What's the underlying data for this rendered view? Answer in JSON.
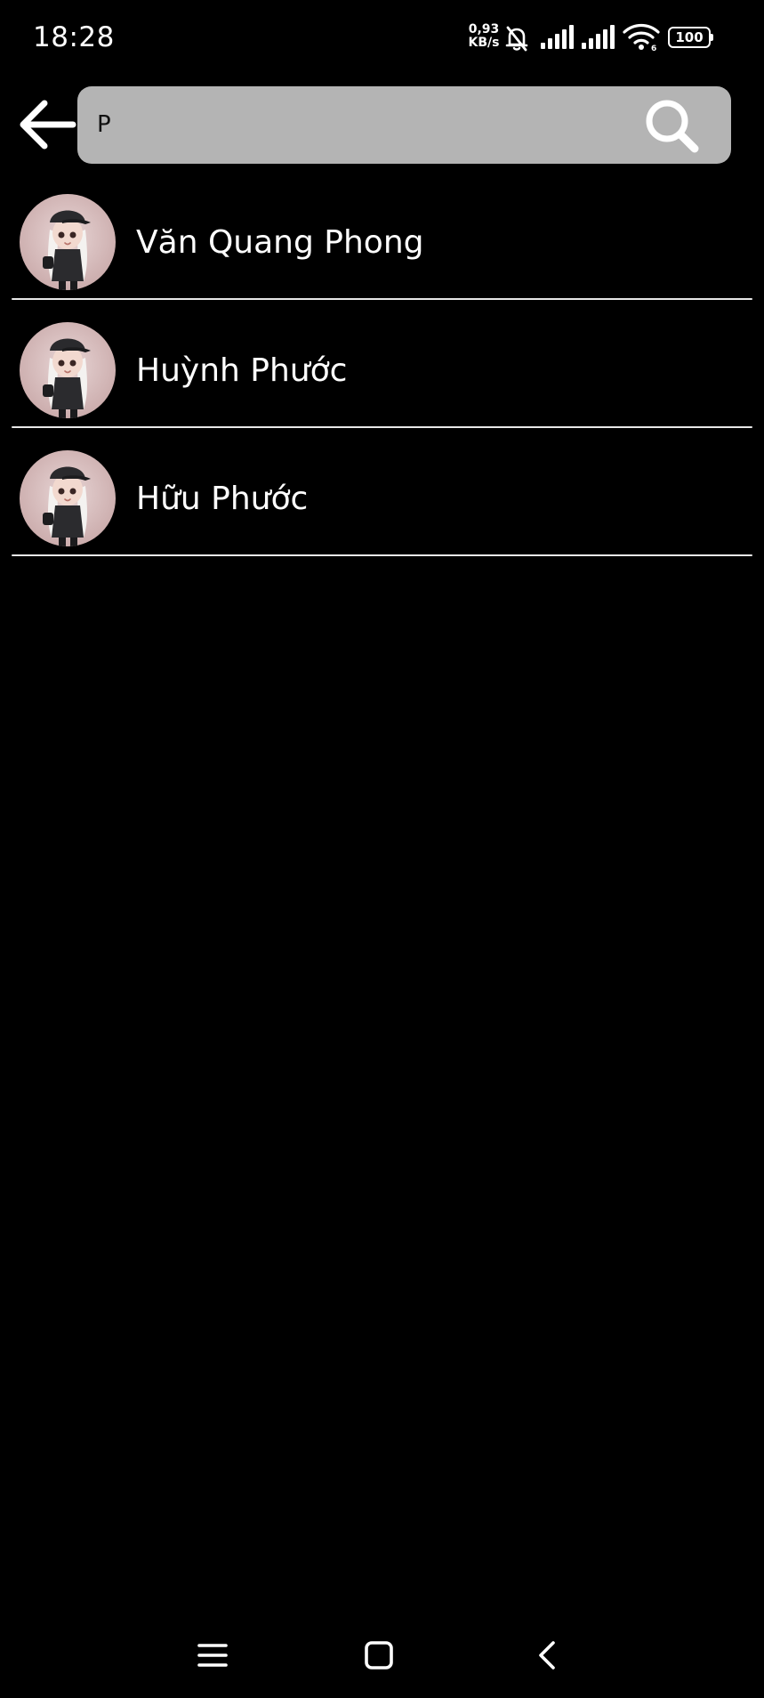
{
  "status_bar": {
    "time": "18:28",
    "net_speed_value": "0,93",
    "net_speed_unit": "KB/s",
    "wifi_label": "6",
    "battery_level": "100"
  },
  "search": {
    "value": "P",
    "placeholder": ""
  },
  "results": [
    {
      "name": "Văn Quang Phong"
    },
    {
      "name": "Huỳnh Phước"
    },
    {
      "name": "Hữu Phước"
    }
  ],
  "icons": {
    "back": "arrow-left-icon",
    "search": "magnifier-icon",
    "nav_menu": "menu-icon",
    "nav_home": "home-square-icon",
    "nav_back": "chevron-left-icon"
  },
  "colors": {
    "background": "#000000",
    "search_box": "#b4b4b4",
    "text": "#ffffff",
    "divider": "#e8e8e8"
  }
}
